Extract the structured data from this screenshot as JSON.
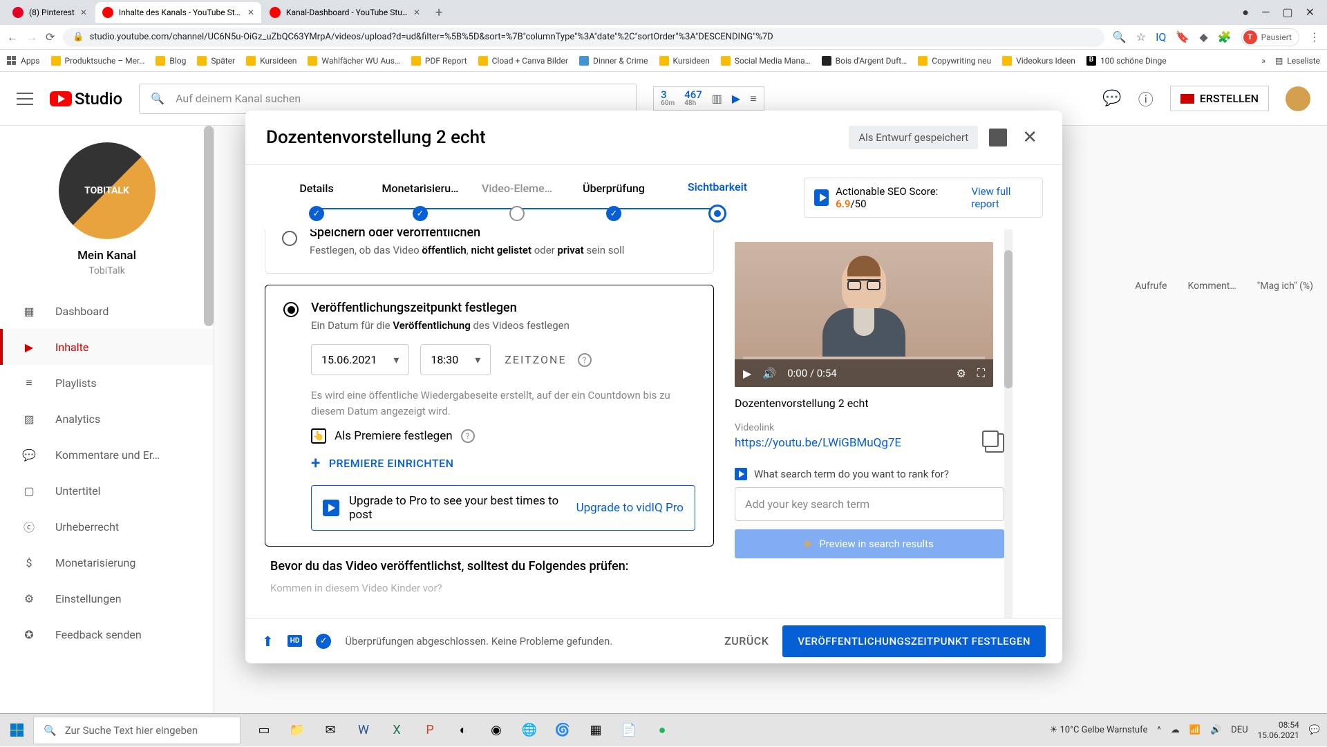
{
  "browser": {
    "tabs": [
      {
        "title": "(8) Pinterest",
        "favicon_color": "#e60023"
      },
      {
        "title": "Inhalte des Kanals - YouTube Stu…",
        "favicon_color": "#ff0000"
      },
      {
        "title": "Kanal-Dashboard - YouTube Stu…",
        "favicon_color": "#ff0000"
      }
    ],
    "url": "studio.youtube.com/channel/UC6N5u-OiGz_uZbQC63YMrpA/videos/upload?d=ud&filter=%5B%5D&sort=%7B\"columnType\"%3A\"date\"%2C\"sortOrder\"%3A\"DESCENDING\"%7D",
    "pause_label": "Pausiert",
    "bookmarks": [
      "Apps",
      "Produktsuche – Mer…",
      "Blog",
      "Später",
      "Kursideen",
      "Wahlfächer WU Aus…",
      "PDF Report",
      "Cload + Canva Bilder",
      "Dinner & Crime",
      "Kursideen",
      "Social Media Mana…",
      "Bois d'Argent Duft…",
      "Copywriting neu",
      "Videokurs Ideen",
      "100 schöne Dinge",
      "Leseliste"
    ]
  },
  "header": {
    "logo_text": "Studio",
    "search_placeholder": "Auf deinem Kanal suchen",
    "stats": {
      "a": "3",
      "a_sub": "60m",
      "b": "467",
      "b_sub": "48h"
    },
    "create_label": "ERSTELLEN"
  },
  "sidebar": {
    "channel_avatar_text": "TOBITALK",
    "channel_label": "Mein Kanal",
    "channel_name": "TobiTalk",
    "items": [
      {
        "label": "Dashboard"
      },
      {
        "label": "Inhalte"
      },
      {
        "label": "Playlists"
      },
      {
        "label": "Analytics"
      },
      {
        "label": "Kommentare und Er…"
      },
      {
        "label": "Untertitel"
      },
      {
        "label": "Urheberrecht"
      },
      {
        "label": "Monetarisierung"
      },
      {
        "label": "Einstellungen"
      },
      {
        "label": "Feedback senden"
      }
    ]
  },
  "bg": {
    "col1": "Aufrufe",
    "col2": "Komment…",
    "col3": "\"Mag ich\" (%)"
  },
  "modal": {
    "title": "Dozentenvorstellung 2 echt",
    "draft": "Als Entwurf gespeichert",
    "steps": [
      "Details",
      "Monetarisieru…",
      "Video-Eleme…",
      "Überprüfung",
      "Sichtbarkeit"
    ],
    "seo": {
      "label": "Actionable SEO Score:",
      "score": "6.9",
      "max": "/50",
      "link": "View full report"
    },
    "opt1": {
      "title": "Speichern oder veröffentlichen",
      "desc_pre": "Festlegen, ob das Video ",
      "b1": "öffentlich",
      "mid1": ", ",
      "b2": "nicht gelistet",
      "mid2": " oder ",
      "b3": "privat",
      "post": " sein soll"
    },
    "opt2": {
      "title": "Veröffentlichungszeitpunkt festlegen",
      "desc_pre": "Ein Datum für die ",
      "b1": "Veröffentlichung",
      "post": " des Videos festlegen",
      "date": "15.06.2021",
      "time": "18:30",
      "tz_label": "ZEITZONE",
      "hint": "Es wird eine öffentliche Wiedergabeseite erstellt, auf der ein Countdown bis zu diesem Datum angezeigt wird.",
      "premiere_label": "Als Premiere festlegen",
      "premiere_setup": "PREMIERE EINRICHTEN",
      "upgrade_text": "Upgrade to Pro to see your best times to post",
      "upgrade_link": "Upgrade to vidIQ Pro"
    },
    "check": {
      "title": "Bevor du das Video veröffentlichst, solltest du Folgendes prüfen:",
      "q": "Kommen in diesem Video Kinder vor?"
    },
    "preview": {
      "time": "0:00 / 0:54",
      "title": "Dozentenvorstellung 2 echt",
      "link_label": "Videolink",
      "link": "https://youtu.be/LWiGBMuQg7E",
      "rank_q": "What search term do you want to rank for?",
      "rank_placeholder": "Add your key search term",
      "preview_btn": "Preview in search results"
    },
    "footer": {
      "status": "Überprüfungen abgeschlossen. Keine Probleme gefunden.",
      "back": "ZURÜCK",
      "primary": "VERÖFFENTLICHUNGSZEITPUNKT FESTLEGEN"
    }
  },
  "taskbar": {
    "search_placeholder": "Zur Suche Text hier eingeben",
    "weather": "10°C  Gelbe Warnstufe",
    "lang": "DEU",
    "time": "08:54",
    "date": "15.06.2021"
  }
}
